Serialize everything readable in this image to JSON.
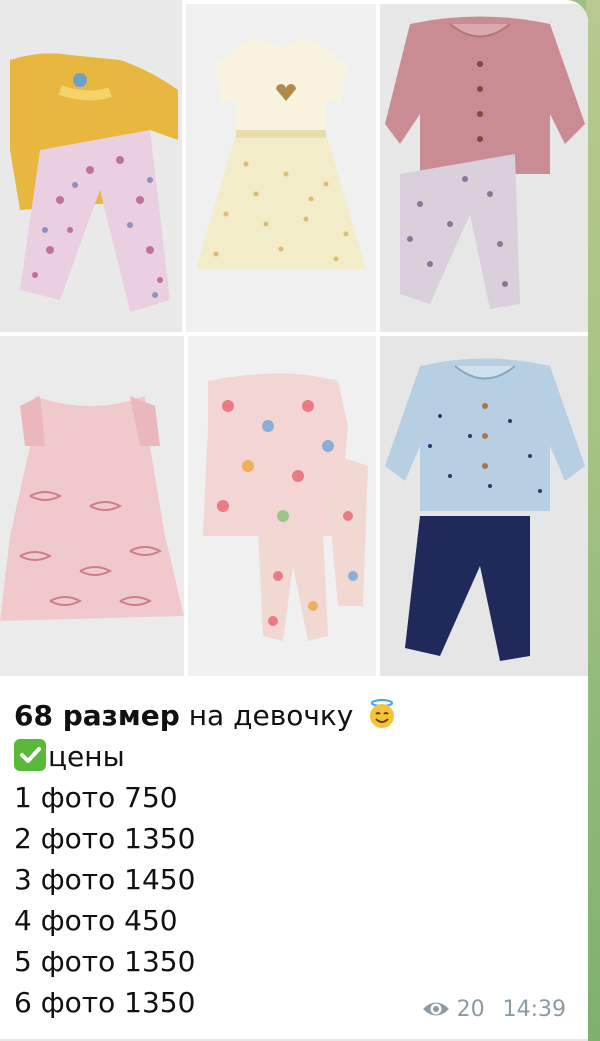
{
  "message": {
    "photos": [
      {
        "index": 1,
        "alt": "yellow top and floral leggings"
      },
      {
        "index": 2,
        "alt": "white tulle dress with heart"
      },
      {
        "index": 3,
        "alt": "pink blouse and floral leggings"
      },
      {
        "index": 4,
        "alt": "pink dress with whale print"
      },
      {
        "index": 5,
        "alt": "floral top and leggings set"
      },
      {
        "index": 6,
        "alt": "blue blouse and navy leggings"
      }
    ],
    "caption": {
      "title_bold": "68 размер",
      "title_rest": " на девочку",
      "prices_label": "цены",
      "prices": [
        "1 фото 750",
        "2 фото 1350",
        "3 фото 1450",
        "4 фото 450",
        "5 фото 1350",
        "6 фото 1350"
      ]
    },
    "views": "20",
    "time": "14:39"
  },
  "colors": {
    "bubble_bg": "#ffffff",
    "text": "#111111",
    "meta_text": "#8c9aa3",
    "check_green": "#59b839"
  },
  "icons": [
    "smiling-face-with-halo-emoji",
    "check-mark-button-emoji",
    "eye-icon"
  ]
}
